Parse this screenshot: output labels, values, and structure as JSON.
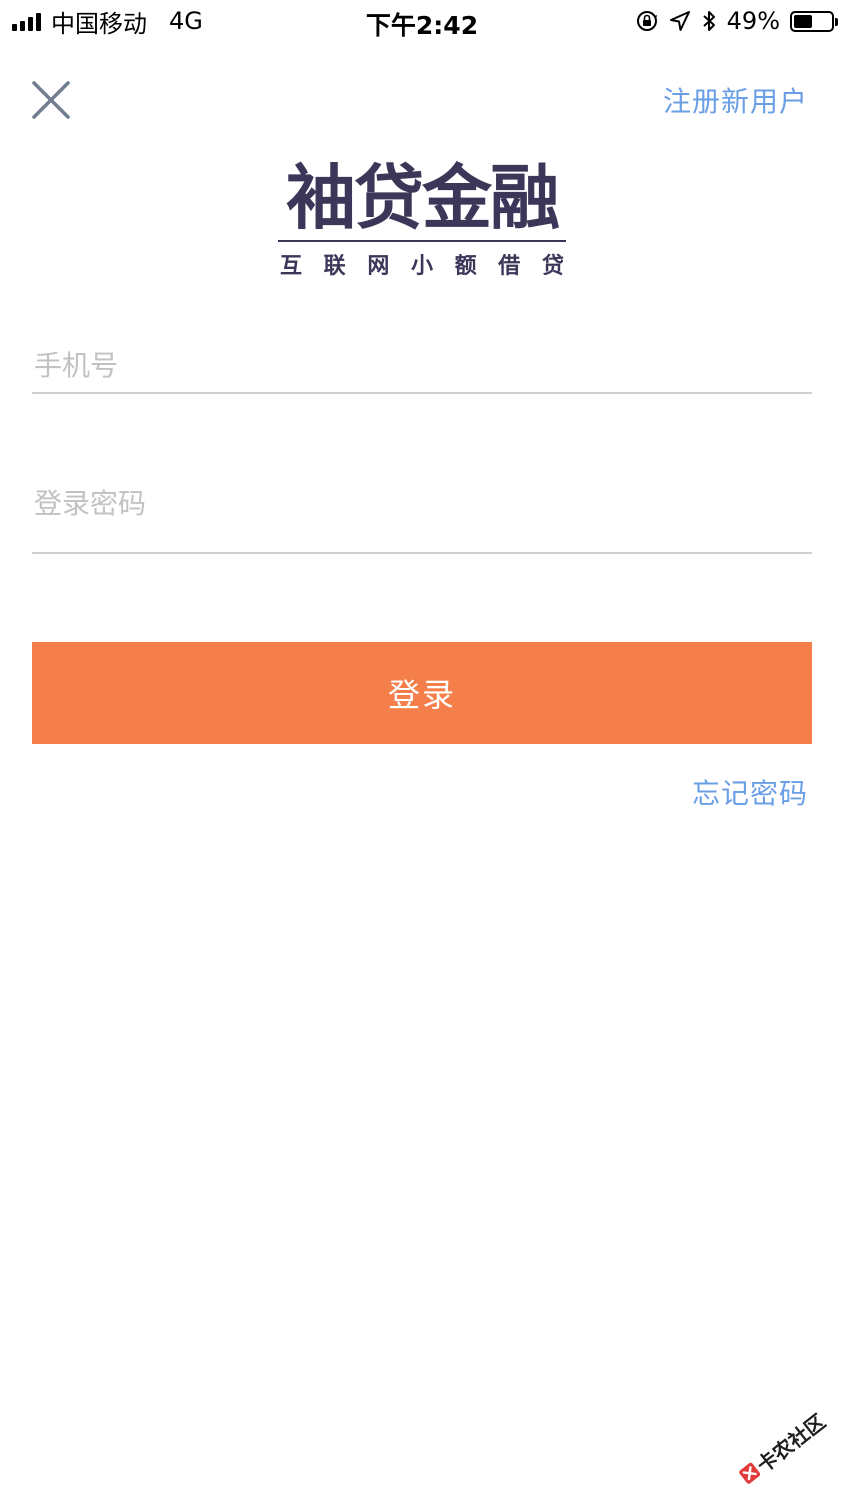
{
  "status_bar": {
    "carrier": "中国移动",
    "network": "4G",
    "time": "下午2:42",
    "battery": "49%",
    "battery_level": 0.49
  },
  "nav": {
    "close_icon": "close-icon",
    "register_label": "注册新用户"
  },
  "logo": {
    "title": "袖贷金融",
    "subtitle_chars": [
      "互",
      "联",
      "网",
      "小",
      "额",
      "借",
      "贷"
    ]
  },
  "form": {
    "phone_placeholder": "手机号",
    "phone_value": "",
    "password_placeholder": "登录密码",
    "password_value": "",
    "login_label": "登录",
    "forgot_label": "忘记密码"
  },
  "watermark": {
    "text": "卡农社区"
  },
  "colors": {
    "accent": "#f57f4a",
    "link": "#6a9fe6",
    "brand": "#3e3659",
    "placeholder": "#c2c2c2",
    "divider": "#cfcfcf"
  }
}
